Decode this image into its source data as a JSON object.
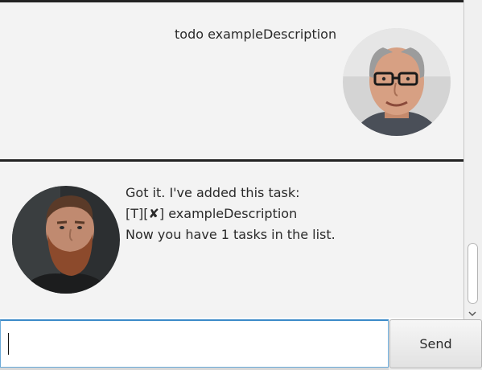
{
  "conversation": {
    "user_message": "todo exampleDescription",
    "bot_message": {
      "line_1": "Got it. I've added this task:",
      "line_2": "[T][✘] exampleDescription",
      "line_3": "Now you have 1 tasks in the list."
    },
    "user_avatar_icon": "user-avatar-icon",
    "bot_avatar_icon": "bot-avatar-icon"
  },
  "input": {
    "value": "",
    "send_label": "Send"
  },
  "colors": {
    "chat_background": "#f3f3f3",
    "divider": "#222222",
    "input_focus_border": "#3c8ac8"
  }
}
